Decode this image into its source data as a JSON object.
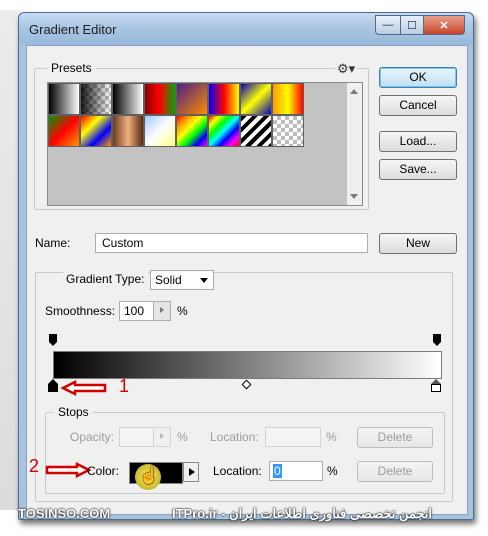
{
  "window": {
    "title": "Gradient Editor"
  },
  "title_buttons": {
    "minimize": "—",
    "maximize": "☐",
    "close": "✕"
  },
  "presets": {
    "label": "Presets",
    "menu_icon": "gear-icon",
    "swatches": [
      "linear-gradient(to right,#000,#fff)",
      "checker-fade",
      "linear-gradient(to right,#000,#fff)",
      "linear-gradient(to right,#8b0000,#ff0000,#00aa00)",
      "linear-gradient(to bottom right,#4b1f86,#ff8c00)",
      "linear-gradient(to right,#0000ff,#ff0000,#ffff00)",
      "linear-gradient(to bottom right,#0000c0,#ffff00,#0000c0)",
      "linear-gradient(to right,#ff9900,#ffff00,#ff0000)",
      "linear-gradient(to bottom right,#009900,#ff0000,#ff9900)",
      "linear-gradient(to bottom right,#ff0000,#ffff00,#0000ff,#ff9900)",
      "linear-gradient(to right,#6b3a1e,#f0b080,#5a2a10)",
      "linear-gradient(to bottom right,#a0c8ff,#ffffff,#ffff80)",
      "linear-gradient(to bottom right,#ff0000,#ff9900,#ffff00,#00ff00,#0000ff,#ff00ff)",
      "linear-gradient(to bottom right,#ff0000,#ffff00,#00ff00,#00ffff,#0000ff,#ff00ff,#ff0000)",
      "repeating-linear-gradient(135deg,#000 0 4px,#fff 4px 8px)",
      "checker"
    ]
  },
  "buttons": {
    "ok": "OK",
    "cancel": "Cancel",
    "load": "Load...",
    "save": "Save...",
    "new": "New"
  },
  "name": {
    "label": "Name:",
    "value": "Custom"
  },
  "gradient_type": {
    "label": "Gradient Type:",
    "value": "Solid"
  },
  "smoothness": {
    "label": "Smoothness:",
    "value": "100",
    "unit": "%"
  },
  "gradient": {
    "start_color": "#000000",
    "end_color": "#ffffff"
  },
  "stops": {
    "label": "Stops",
    "opacity": {
      "label": "Opacity:",
      "value": "",
      "unit": "%",
      "location_label": "Location:",
      "location_value": "",
      "location_unit": "%",
      "delete": "Delete"
    },
    "color": {
      "label": "Color:",
      "swatch": "#000000",
      "location_label": "Location:",
      "location_value": "0",
      "location_unit": "%",
      "delete": "Delete"
    }
  },
  "annotations": {
    "one": "1",
    "two": "2",
    "color": "#d40000"
  },
  "watermark": {
    "left": "TOSINSO.COM",
    "right": "ITPro.ir - انجمن تخصصی فناوری اطلاعات ایران"
  }
}
